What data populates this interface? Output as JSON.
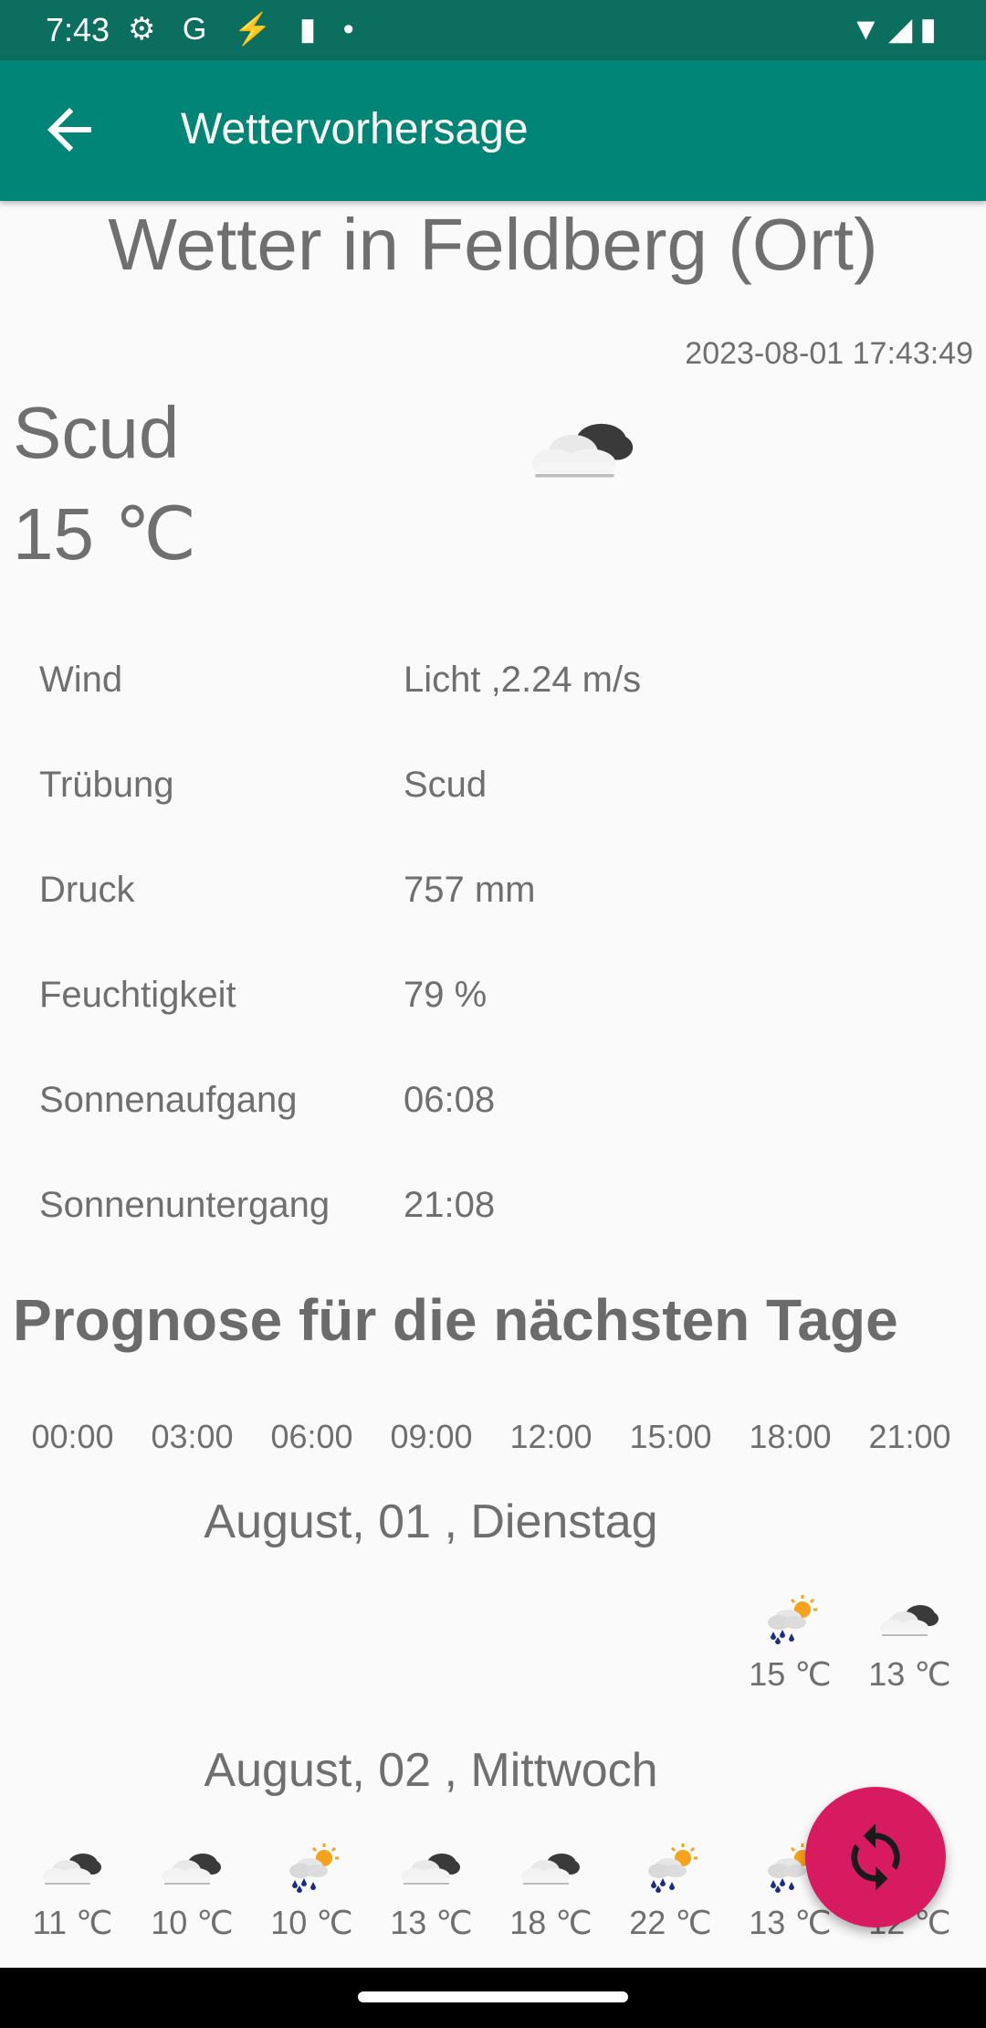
{
  "status_bar": {
    "time": "7:43",
    "left_icons": "⚙ G ⚡ ▮ •",
    "right_icons": "▼◢▮"
  },
  "app_bar": {
    "back_icon": "arrow-left-icon",
    "title": "Wettervorhersage"
  },
  "current": {
    "city_title": "Wetter in Feldberg (Ort)",
    "updated": "2023-08-01 17:43:49",
    "description": "Scud",
    "temperature": "15 ℃",
    "icon": "cloudy-icon"
  },
  "details": [
    {
      "label": "Wind",
      "value": "Licht ,2.24 m/s"
    },
    {
      "label": "Trübung",
      "value": "Scud"
    },
    {
      "label": "Druck",
      "value": "757 mm"
    },
    {
      "label": "Feuchtigkeit",
      "value": "79 %"
    },
    {
      "label": "Sonnenaufgang",
      "value": "06:08"
    },
    {
      "label": "Sonnenuntergang",
      "value": "21:08"
    }
  ],
  "forecast": {
    "title": "Prognose für die nächsten Tage",
    "hours": [
      "00:00",
      "03:00",
      "06:00",
      "09:00",
      "12:00",
      "15:00",
      "18:00",
      "21:00"
    ],
    "days": [
      {
        "label": "August, 01 , Dienstag",
        "entries": [
          {
            "slot": 6,
            "icon": "rain-sun-icon",
            "temp": "15 ℃"
          },
          {
            "slot": 7,
            "icon": "cloudy-icon",
            "temp": "13 ℃"
          }
        ]
      },
      {
        "label": "August, 02 , Mittwoch",
        "entries": [
          {
            "slot": 0,
            "icon": "cloudy-icon",
            "temp": "11 ℃"
          },
          {
            "slot": 1,
            "icon": "cloudy-icon",
            "temp": "10 ℃"
          },
          {
            "slot": 2,
            "icon": "rain-sun-icon",
            "temp": "10 ℃"
          },
          {
            "slot": 3,
            "icon": "cloudy-icon",
            "temp": "13 ℃"
          },
          {
            "slot": 4,
            "icon": "cloudy-icon",
            "temp": "18 ℃"
          },
          {
            "slot": 5,
            "icon": "rain-sun-icon",
            "temp": "22 ℃"
          },
          {
            "slot": 6,
            "icon": "rain-sun-icon",
            "temp": "13 ℃"
          },
          {
            "slot": 7,
            "icon": "cloudy-icon",
            "temp": "12 ℃"
          }
        ]
      }
    ]
  },
  "fab": {
    "icon": "refresh-icon"
  },
  "colors": {
    "status_bar": "#0b6e5e",
    "app_bar": "#008577",
    "fab": "#d81b60",
    "text": "#6f6f6f"
  }
}
